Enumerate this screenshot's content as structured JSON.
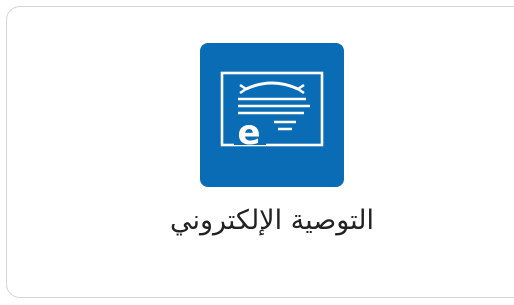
{
  "service_card": {
    "label": "التوصية الإلكتروني",
    "icon": "e-document-icon",
    "tile_color": "#0a6cb5",
    "icon_letter": "e"
  }
}
